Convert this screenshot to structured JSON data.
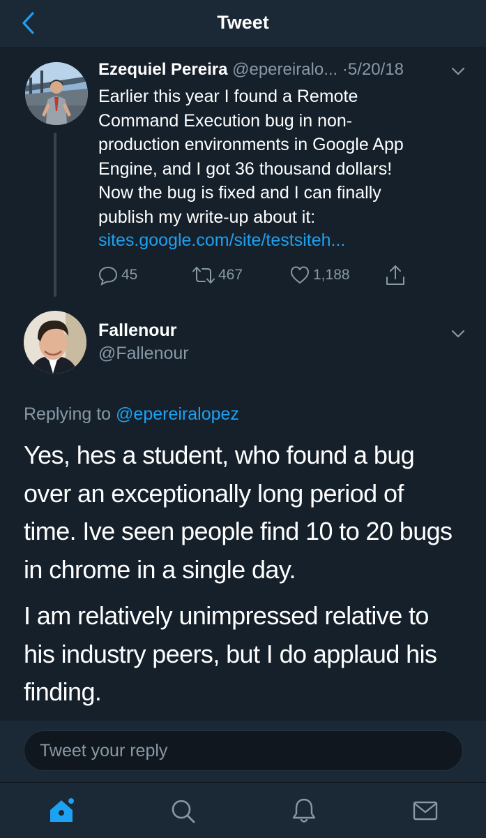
{
  "header": {
    "title": "Tweet",
    "back_icon": "chevron-left-icon"
  },
  "quoted_tweet": {
    "author_name": "Ezequiel Pereira",
    "author_handle": "@epereiralo...",
    "dot": "·",
    "date": "5/20/18",
    "body": "Earlier this year I found a Remote Command Execution bug in non-production environments in Google App Engine, and I got 36 thousand dollars! Now the bug is fixed and I can finally publish my write-up about it:",
    "body_lines": [
      "Earlier this year I found a Remote",
      "Command Execution bug in non-",
      "production environments in Google App",
      "Engine, and I got 36 thousand dollars!",
      "Now the bug is fixed and I can finally",
      "publish my write-up about it:"
    ],
    "link": "sites.google.com/site/testsiteh...",
    "replies": "45",
    "retweets": "467",
    "likes": "1,188"
  },
  "main_tweet": {
    "author_name": "Fallenour",
    "author_handle": "@Fallenour",
    "replying_prefix": "Replying to",
    "replying_to": "@epereiralopez",
    "paragraphs": [
      "Yes, hes a student, who found a bug over an exceptionally long period of time. Ive seen people find 10 to 20 bugs in chrome in a single day.",
      "I am relatively unimpressed relative to his industry peers, but I do applaud his finding."
    ],
    "paragraph_lines": [
      [
        "Yes, hes a student, who found a bug",
        "over an exceptionally long period of",
        "time. Ive seen people find 10 to 20 bugs",
        "in chrome in a single day."
      ],
      [
        "I am relatively unimpressed relative to",
        "his industry peers, but I do applaud his",
        "finding."
      ]
    ]
  },
  "reply_bar": {
    "placeholder": "Tweet your reply"
  },
  "tab_bar": {
    "items": [
      {
        "icon": "home-icon",
        "active": true
      },
      {
        "icon": "search-icon",
        "active": false
      },
      {
        "icon": "bell-icon",
        "active": false
      },
      {
        "icon": "mail-icon",
        "active": false
      }
    ]
  },
  "colors": {
    "background": "#15202b",
    "bar": "#1b2836",
    "accent": "#1da1f2",
    "secondary_text": "#8899a6"
  }
}
